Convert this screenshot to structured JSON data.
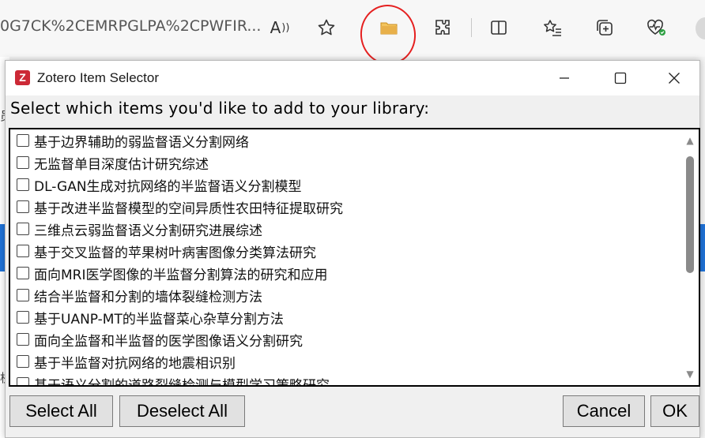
{
  "browser": {
    "url_fragment": "0G7CK%2CEMRPGLPA%2CPWFIR...",
    "icons": [
      "read-aloud-icon",
      "favorite-star-icon",
      "zotero-folder-icon",
      "extensions-icon",
      "split-screen-icon",
      "favorites-list-icon",
      "collections-icon",
      "browser-health-icon"
    ],
    "read_aloud_glyph": "Á",
    "bg_char_1": "员",
    "bg_char_2": "杭"
  },
  "dialog": {
    "app_icon_letter": "Z",
    "title": "Zotero Item Selector",
    "prompt": "Select which items you'd like to add to your library:",
    "items": [
      {
        "label": "基于边界辅助的弱监督语义分割网络",
        "checked": false
      },
      {
        "label": "无监督单目深度估计研究综述",
        "checked": false
      },
      {
        "label": "DL-GAN生成对抗网络的半监督语义分割模型",
        "checked": false
      },
      {
        "label": "基于改进半监督模型的空间异质性农田特征提取研究",
        "checked": false
      },
      {
        "label": "三维点云弱监督语义分割研究进展综述",
        "checked": false
      },
      {
        "label": "基于交叉监督的苹果树叶病害图像分类算法研究",
        "checked": false
      },
      {
        "label": "面向MRI医学图像的半监督分割算法的研究和应用",
        "checked": false
      },
      {
        "label": "结合半监督和分割的墙体裂缝检测方法",
        "checked": false
      },
      {
        "label": "基于UANP-MT的半监督菜心杂草分割方法",
        "checked": false
      },
      {
        "label": "面向全监督和半监督的医学图像语义分割研究",
        "checked": false
      },
      {
        "label": "基于半监督对抗网络的地震相识别",
        "checked": false
      },
      {
        "label": "基于语义分割的道路裂缝检测与模型学习策略研究",
        "checked": false
      }
    ],
    "buttons": {
      "select_all": "Select All",
      "deselect_all": "Deselect All",
      "cancel": "Cancel",
      "ok": "OK"
    }
  },
  "colors": {
    "annotation": "#e52020",
    "zotero_red": "#cc2936",
    "folder_yellow": "#e8b04a",
    "health_green": "#2ea043"
  }
}
